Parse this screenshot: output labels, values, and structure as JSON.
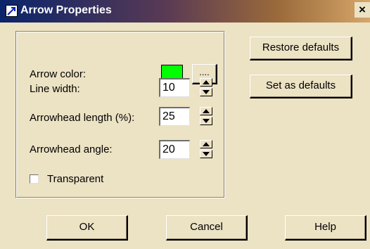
{
  "window": {
    "title": "Arrow Properties",
    "close_label": "×"
  },
  "form": {
    "arrow_color_label": "Arrow color:",
    "arrow_color_value": "#00ff00",
    "browse_color_label": "....",
    "line_width_label": "Line width:",
    "line_width_value": "10",
    "arrowhead_length_label": "Arrowhead length (%):",
    "arrowhead_length_value": "25",
    "arrowhead_angle_label": "Arrowhead angle:",
    "arrowhead_angle_value": "20",
    "transparent_label": "Transparent",
    "transparent_checked": false
  },
  "side_buttons": {
    "restore_defaults": "Restore defaults",
    "set_as_defaults": "Set as defaults"
  },
  "bottom_buttons": {
    "ok": "OK",
    "cancel": "Cancel",
    "help": "Help"
  },
  "colors": {
    "dialog_bg": "#ece2c4",
    "title_gradient_start": "#0a246a",
    "title_gradient_end": "#d6a66a"
  }
}
